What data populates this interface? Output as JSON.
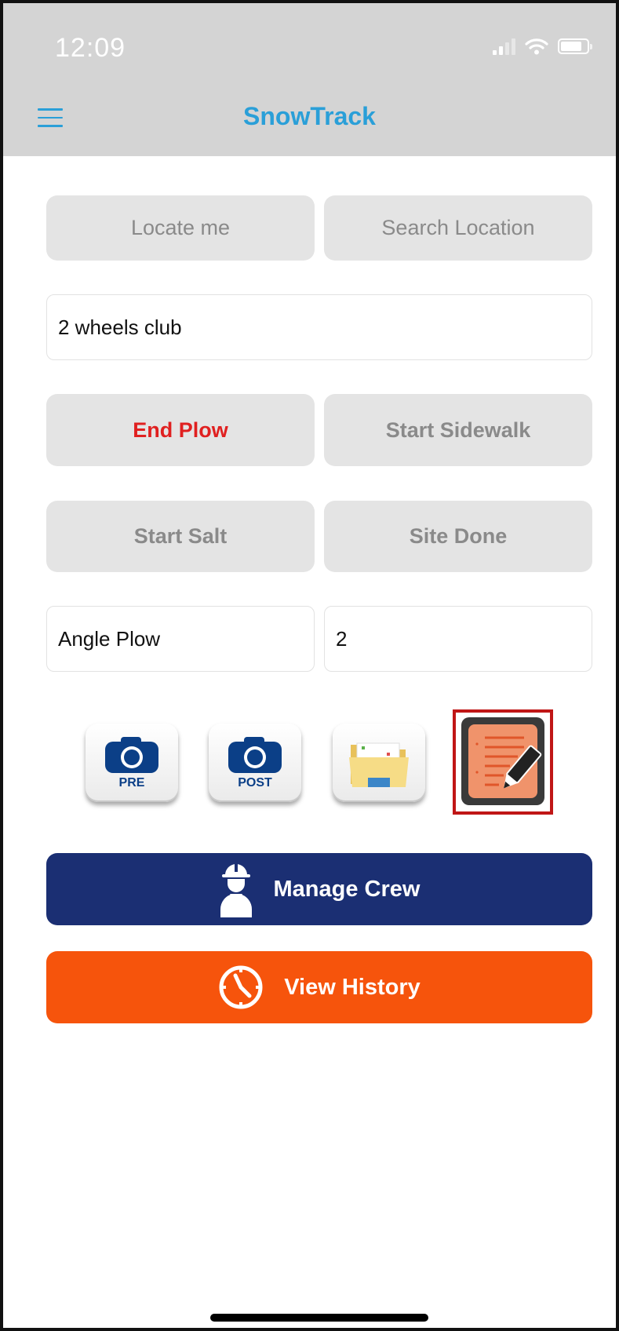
{
  "status": {
    "time": "12:09"
  },
  "nav": {
    "title": "SnowTrack"
  },
  "location_buttons": {
    "locate": "Locate me",
    "search": "Search Location"
  },
  "site_name": "2 wheels club",
  "actions": {
    "end_plow": "End Plow",
    "start_sidewalk": "Start Sidewalk",
    "start_salt": "Start Salt",
    "site_done": "Site Done"
  },
  "equipment": {
    "type": "Angle Plow",
    "quantity": "2"
  },
  "photo_icons": {
    "pre": "PRE",
    "post": "POST"
  },
  "crew_button": "Manage Crew",
  "history_button": "View History",
  "colors": {
    "accent": "#2a9fd8",
    "danger": "#e02020",
    "crew": "#1b2f73",
    "history": "#f6540c",
    "highlight": "#c01616"
  }
}
